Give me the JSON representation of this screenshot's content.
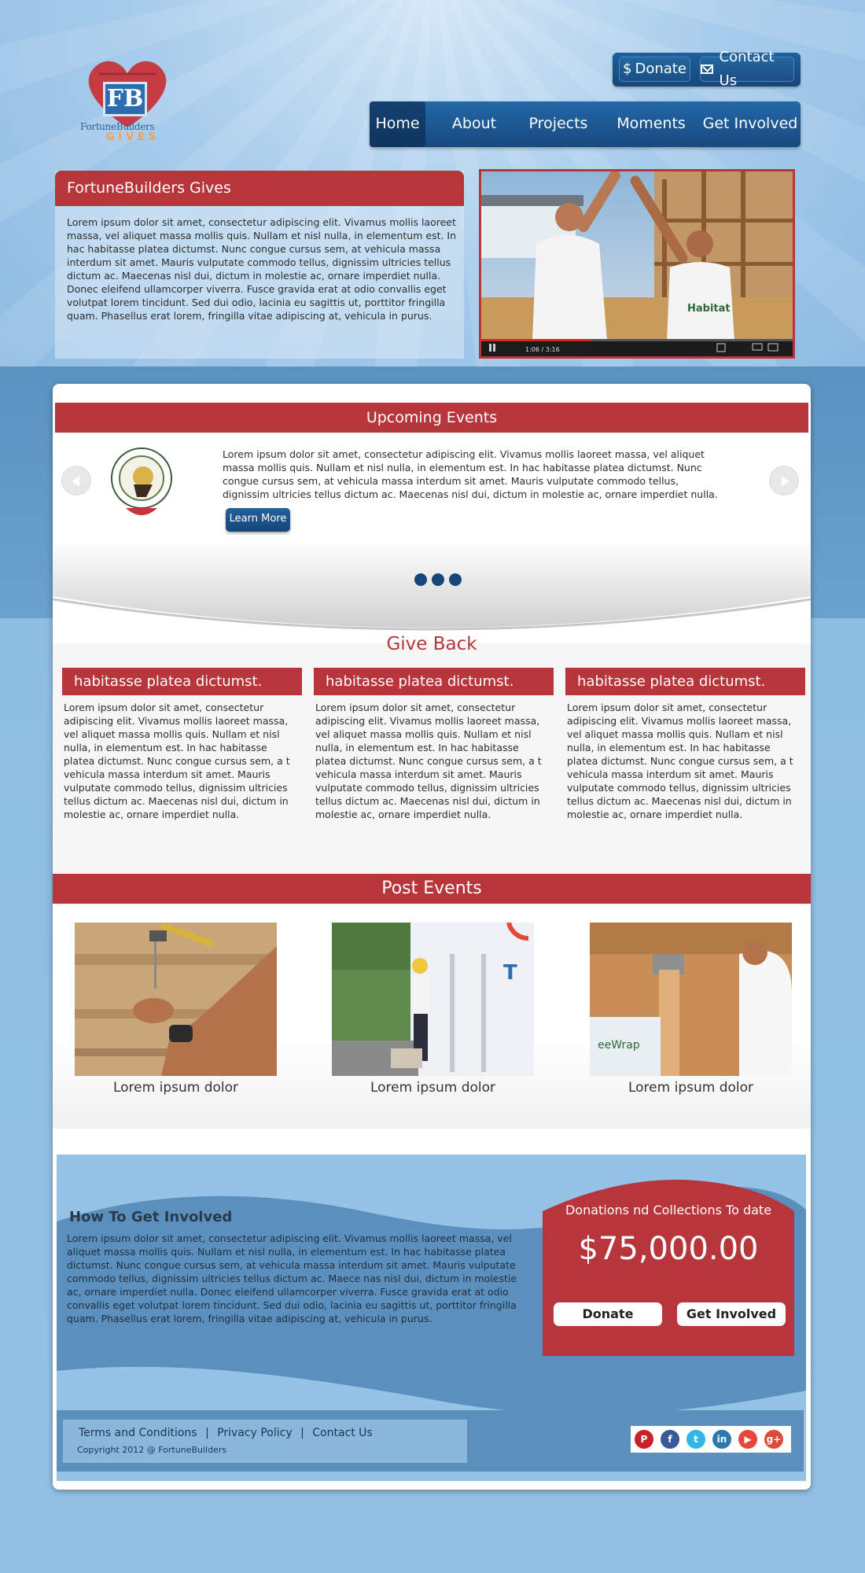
{
  "brand": {
    "logo_initials": "FB",
    "logo_name": "FortuneBuilders",
    "logo_tagline": "GIVES"
  },
  "header_buttons": {
    "donate": "Donate",
    "contact": "Contact Us"
  },
  "nav": {
    "items": [
      "Home",
      "About",
      "Projects",
      "Moments",
      "Get Involved"
    ],
    "active": "Home"
  },
  "intro": {
    "title": "FortuneBuilders Gives",
    "text": "Lorem ipsum dolor sit amet, consectetur adipiscing elit. Vivamus mollis laoreet massa, vel aliquet massa mollis quis. Nullam et nisl nulla, in elementum est. In hac habitasse platea dictumst. Nunc congue cursus sem, at vehicula massa interdum sit amet. Mauris vulputate commodo tellus, dignissim ultricies tellus dictum ac. Maecenas nisl dui, dictum in molestie ac, ornare imperdiet nulla. Donec eleifend ullamcorper viverra. Fusce gravida erat at odio convallis eget volutpat lorem tincidunt. Sed dui odio, lacinia eu sagittis ut, porttitor fringilla quam. Phasellus erat lorem, fringilla vitae adipiscing at, vehicula in purus."
  },
  "video": {
    "time": "1:06 / 3:16",
    "progress": 0.35
  },
  "upcoming": {
    "title": "Upcoming Events",
    "text": "Lorem ipsum dolor sit amet, consectetur adipiscing elit. Vivamus mollis laoreet massa, vel aliquet massa mollis quis. Nullam et nisl nulla, in elementum est. In hac habitasse platea dictumst. Nunc congue cursus sem, at vehicula massa interdum sit amet. Mauris vulputate commodo tellus, dignissim ultricies tellus dictum ac. Maecenas nisl dui, dictum in molestie ac, ornare imperdiet nulla.",
    "button": "Learn More",
    "slides": 3
  },
  "giveback": {
    "title": "Give Back",
    "columns": [
      {
        "heading": "habitasse platea dictumst.",
        "text": "Lorem ipsum dolor sit amet, consectetur adipiscing elit. Vivamus mollis laoreet massa, vel aliquet massa mollis quis. Nullam et nisl nulla, in elementum est. In hac habitasse platea dictumst. Nunc congue cursus sem, a t vehicula massa interdum sit amet. Mauris vulputate commodo tellus, dignissim ultricies tellus dictum ac. Maecenas nisl dui, dictum in molestie ac, ornare imperdiet nulla."
      },
      {
        "heading": "habitasse platea dictumst.",
        "text": "Lorem ipsum dolor sit amet, consectetur adipiscing elit. Vivamus mollis laoreet massa, vel aliquet massa mollis quis. Nullam et nisl nulla, in elementum est. In hac habitasse platea dictumst. Nunc congue cursus sem, a t vehicula massa interdum sit amet. Mauris vulputate commodo tellus, dignissim ultricies tellus dictum ac. Maecenas nisl dui, dictum in molestie ac, ornare imperdiet nulla."
      },
      {
        "heading": "habitasse platea dictumst.",
        "text": "Lorem ipsum dolor sit amet, consectetur adipiscing elit. Vivamus mollis laoreet massa, vel aliquet massa mollis quis. Nullam et nisl nulla, in elementum est. In hac habitasse platea dictumst. Nunc congue cursus sem, a t vehicula massa interdum sit amet. Mauris vulputate commodo tellus, dignissim ultricies tellus dictum ac. Maecenas nisl dui, dictum in molestie ac, ornare imperdiet nulla."
      }
    ]
  },
  "post_events": {
    "title": "Post Events",
    "captions": [
      "Lorem ipsum dolor",
      "Lorem ipsum dolor",
      "Lorem ipsum dolor"
    ]
  },
  "involved": {
    "title": "How To Get Involved",
    "text": "Lorem ipsum dolor sit amet, consectetur adipiscing elit. Vivamus mollis laoreet massa, vel aliquet massa mollis quis. Nullam et nisl nulla, in elementum est. In hac habitasse platea dictumst. Nunc congue cursus sem, at vehicula massa interdum sit amet. Mauris vulputate commodo tellus, dignissim ultricies tellus dictum ac. Maece nas nisl dui, dictum in molestie ac, ornare imperdiet nulla. Donec eleifend ullamcorper viverra. Fusce gravida erat at odio convallis eget volutpat lorem tincidunt. Sed dui odio, lacinia eu sagittis ut, porttitor fringilla quam. Phasellus erat lorem, fringilla vitae adipiscing at, vehicula in purus."
  },
  "donations": {
    "label": "Donations nd Collections To date",
    "amount": "$75,000.00",
    "donate_button": "Donate",
    "involved_button": "Get Involved"
  },
  "footer": {
    "links": [
      "Terms and Conditions",
      "Privacy Policy",
      "Contact Us"
    ],
    "separator": "|",
    "copyright": "Copyright 2012 @ FortuneBuilders",
    "social": [
      {
        "name": "pinterest-icon",
        "glyph": "P",
        "color": "#cb2027"
      },
      {
        "name": "facebook-icon",
        "glyph": "f",
        "color": "#3b5998"
      },
      {
        "name": "twitter-icon",
        "glyph": "t",
        "color": "#33b5e5"
      },
      {
        "name": "linkedin-icon",
        "glyph": "in",
        "color": "#2a7ab0"
      },
      {
        "name": "youtube-icon",
        "glyph": "▶",
        "color": "#e5473a"
      },
      {
        "name": "google-plus-icon",
        "glyph": "g+",
        "color": "#dd4b39"
      }
    ]
  },
  "colors": {
    "accent_red": "#b6363b",
    "nav_blue": "#17467a",
    "sky_blue": "#8fbce0"
  }
}
